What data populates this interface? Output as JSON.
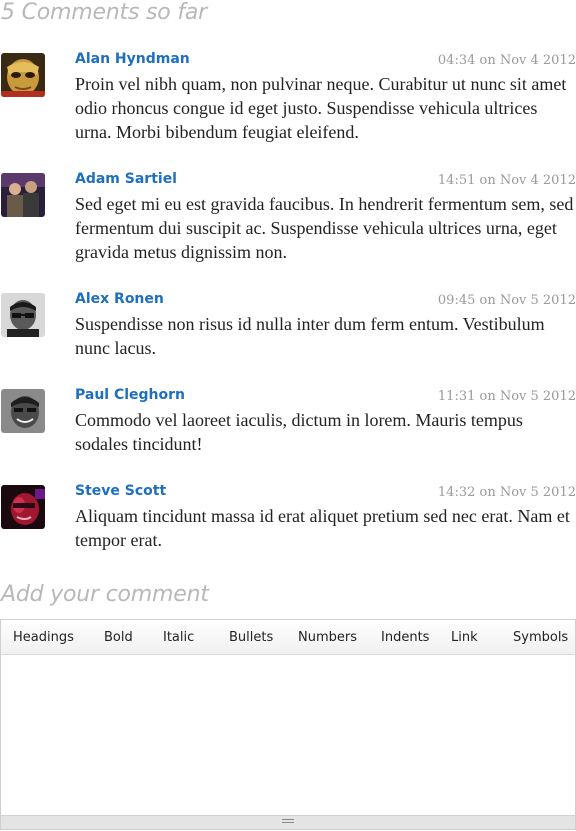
{
  "comments_section": {
    "heading": "5 Comments so far",
    "comments": [
      {
        "author": "Alan Hyndman",
        "time": "04:34 on Nov 4 2012",
        "avatar_icon": "avatar-gold-mask",
        "text": "Proin vel nibh quam, non pulvinar neque. Curabitur ut nunc sit amet odio rhoncus congue id eget justo. Suspendisse vehicula ultrices urna. Morbi bibendum feugiat eleifend."
      },
      {
        "author": "Adam Sartiel",
        "time": "14:51 on Nov 4 2012",
        "avatar_icon": "avatar-two-people",
        "text": "Sed eget mi eu est gravida faucibus. In hendrerit fermentum sem, sed fermentum dui suscipit ac. Suspendisse vehicula ultrices urna, eget gravida metus dignissim non."
      },
      {
        "author": "Alex Ronen",
        "time": "09:45 on Nov 5 2012",
        "avatar_icon": "avatar-man-glasses",
        "text": "Suspendisse non risus id nulla inter dum ferm entum. Vestibulum nunc lacus."
      },
      {
        "author": "Paul Cleghorn",
        "time": "11:31 on Nov 5 2012",
        "avatar_icon": "avatar-man-smiling",
        "text": "Commodo vel laoreet iaculis, dictum in lorem. Mauris tempus sodales tincidunt!"
      },
      {
        "author": "Steve Scott",
        "time": "14:32 on Nov 5 2012",
        "avatar_icon": "avatar-red-lit-face",
        "text": "Aliquam tincidunt massa id erat aliquet pretium sed nec erat. Nam et tempor erat."
      }
    ]
  },
  "add_comment": {
    "heading": "Add your comment",
    "toolbar": {
      "headings": "Headings",
      "bold": "Bold",
      "italic": "Italic",
      "bullets": "Bullets",
      "numbers": "Numbers",
      "indents": "Indents",
      "link": "Link",
      "symbols": "Symbols"
    },
    "textarea_value": ""
  },
  "colors": {
    "author": "#1f6fbf",
    "heading": "#b8b8b8",
    "timestamp": "#9a9a9a",
    "body_text": "#222222"
  }
}
